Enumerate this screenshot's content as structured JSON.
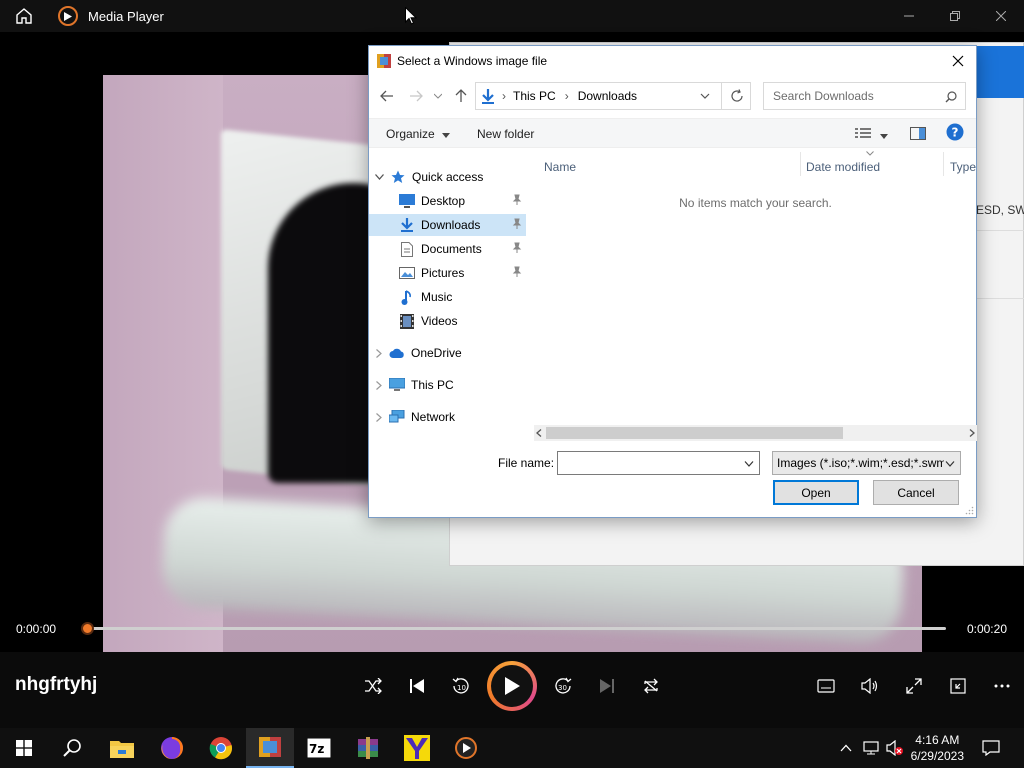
{
  "player": {
    "app_title": "Media Player",
    "time_current": "0:00:00",
    "time_total": "0:00:20",
    "progress": 0,
    "track_title": "nhgfrtyhj"
  },
  "bg_window": {
    "snippet": "ESD, SWM"
  },
  "dialog": {
    "title": "Select a Windows image file",
    "breadcrumb": [
      "This PC",
      "Downloads"
    ],
    "search_placeholder": "Search Downloads",
    "toolbar": {
      "organize": "Organize",
      "new_folder": "New folder"
    },
    "nav": [
      {
        "label": "Quick access",
        "icon": "star-icon"
      },
      {
        "label": "Desktop",
        "icon": "desktop-icon",
        "pinned": true
      },
      {
        "label": "Downloads",
        "icon": "download-icon",
        "pinned": true,
        "selected": true
      },
      {
        "label": "Documents",
        "icon": "document-icon",
        "pinned": true
      },
      {
        "label": "Pictures",
        "icon": "pictures-icon",
        "pinned": true
      },
      {
        "label": "Music",
        "icon": "music-icon"
      },
      {
        "label": "Videos",
        "icon": "video-icon"
      },
      {
        "label": "OneDrive",
        "icon": "cloud-icon"
      },
      {
        "label": "This PC",
        "icon": "computer-icon"
      },
      {
        "label": "Network",
        "icon": "network-icon"
      }
    ],
    "columns": {
      "name": "Name",
      "date_modified": "Date modified",
      "type": "Type"
    },
    "empty_message": "No items match your search.",
    "file_name_label": "File name:",
    "file_name_value": "",
    "file_type": "Images (*.iso;*.wim;*.esd;*.swm)",
    "open_label": "Open",
    "cancel_label": "Cancel"
  },
  "taskbar": {
    "time": "4:16 AM",
    "date": "6/29/2023"
  },
  "colors": {
    "accent_orange": "#f07a2a",
    "selection_blue": "#cce4f7",
    "windows_blue": "#0078d7"
  }
}
